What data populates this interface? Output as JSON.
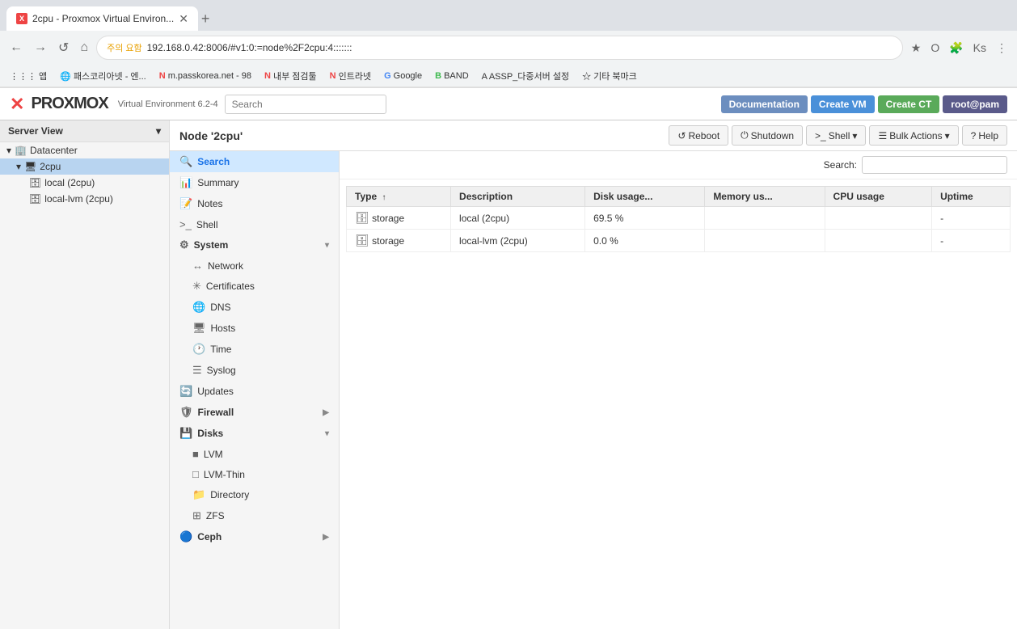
{
  "browser": {
    "tab_title": "2cpu - Proxmox Virtual Environ...",
    "tab_add": "+",
    "back": "←",
    "forward": "→",
    "reload": "↺",
    "home": "⌂",
    "warning_text": "주의 요함",
    "address": "192.168.0.42:8006/#v1:0:=node%2F2cpu:4:::::::",
    "star_icon": "★",
    "opera_icon": "O",
    "ext_icon": "🧩",
    "profile_icon": "Ks",
    "menu_icon": "⋮",
    "bookmarks": [
      {
        "id": "apps",
        "icon": "⋮⋮⋮",
        "label": "앱"
      },
      {
        "id": "passkorea",
        "icon": "🌐",
        "label": "패스코리아넷 - 엔..."
      },
      {
        "id": "mpass",
        "icon": "N",
        "label": "m.passkorea.net - 98"
      },
      {
        "id": "internal",
        "icon": "N",
        "label": "내부 점검툴"
      },
      {
        "id": "intranet",
        "icon": "N",
        "label": "인트라넷"
      },
      {
        "id": "google",
        "icon": "G",
        "label": "Google"
      },
      {
        "id": "band",
        "icon": "B",
        "label": "BAND"
      },
      {
        "id": "assp",
        "icon": "A",
        "label": "ASSP_다중서버 설정"
      },
      {
        "id": "other",
        "icon": "☆",
        "label": "기타 북마크"
      }
    ]
  },
  "app": {
    "logo_text": "PROXMOX",
    "logo_subtitle": "Virtual Environment 6.2-4",
    "search_placeholder": "Search",
    "header_buttons": {
      "documentation": "Documentation",
      "create_vm": "Create VM",
      "create_ct": "Create CT",
      "user": "root@pam"
    }
  },
  "sidebar": {
    "server_view_label": "Server View",
    "items": [
      {
        "id": "datacenter",
        "label": "Datacenter",
        "level": 0,
        "icon": "🏢",
        "expanded": true
      },
      {
        "id": "2cpu",
        "label": "2cpu",
        "level": 1,
        "icon": "💻",
        "selected": true,
        "expanded": true
      },
      {
        "id": "local",
        "label": "local (2cpu)",
        "level": 2,
        "icon": "🗄"
      },
      {
        "id": "local-lvm",
        "label": "local-lvm (2cpu)",
        "level": 2,
        "icon": "🗄"
      }
    ]
  },
  "node_panel": {
    "title": "Node '2cpu'",
    "buttons": {
      "reboot": "Reboot",
      "shutdown": "Shutdown",
      "shell": "Shell",
      "bulk_actions": "Bulk Actions",
      "help": "Help"
    }
  },
  "sub_nav": {
    "items": [
      {
        "id": "search",
        "label": "Search",
        "icon": "🔍",
        "active": true
      },
      {
        "id": "summary",
        "label": "Summary",
        "icon": "📊"
      },
      {
        "id": "notes",
        "label": "Notes",
        "icon": "📝"
      },
      {
        "id": "shell",
        "label": "Shell",
        "icon": ">_"
      },
      {
        "id": "system",
        "label": "System",
        "icon": "⚙",
        "expandable": true,
        "expanded": true
      },
      {
        "id": "network",
        "label": "Network",
        "icon": "↔",
        "sub": true
      },
      {
        "id": "certificates",
        "label": "Certificates",
        "icon": "✳",
        "sub": true
      },
      {
        "id": "dns",
        "label": "DNS",
        "icon": "🌐",
        "sub": true
      },
      {
        "id": "hosts",
        "label": "Hosts",
        "icon": "🖥",
        "sub": true
      },
      {
        "id": "time",
        "label": "Time",
        "icon": "🕐",
        "sub": true
      },
      {
        "id": "syslog",
        "label": "Syslog",
        "icon": "☰",
        "sub": true
      },
      {
        "id": "updates",
        "label": "Updates",
        "icon": "🔄"
      },
      {
        "id": "firewall",
        "label": "Firewall",
        "icon": "🛡",
        "expandable": true
      },
      {
        "id": "disks",
        "label": "Disks",
        "icon": "💾",
        "expandable": true,
        "expanded": true
      },
      {
        "id": "lvm",
        "label": "LVM",
        "icon": "■",
        "sub": true
      },
      {
        "id": "lvm-thin",
        "label": "LVM-Thin",
        "icon": "□",
        "sub": true
      },
      {
        "id": "directory",
        "label": "Directory",
        "icon": "📁",
        "sub": true
      },
      {
        "id": "zfs",
        "label": "ZFS",
        "icon": "⊞",
        "sub": true
      },
      {
        "id": "ceph",
        "label": "Ceph",
        "icon": "🔵",
        "expandable": true
      }
    ]
  },
  "content": {
    "search_label": "Search:",
    "search_placeholder": "",
    "table": {
      "columns": [
        {
          "id": "type",
          "label": "Type",
          "sort": "asc"
        },
        {
          "id": "description",
          "label": "Description"
        },
        {
          "id": "disk_usage",
          "label": "Disk usage..."
        },
        {
          "id": "memory_usage",
          "label": "Memory us..."
        },
        {
          "id": "cpu_usage",
          "label": "CPU usage"
        },
        {
          "id": "uptime",
          "label": "Uptime"
        }
      ],
      "rows": [
        {
          "type": "storage",
          "description": "local (2cpu)",
          "disk_usage": "69.5 %",
          "memory_usage": "",
          "cpu_usage": "",
          "uptime": "-"
        },
        {
          "type": "storage",
          "description": "local-lvm (2cpu)",
          "disk_usage": "0.0 %",
          "memory_usage": "",
          "cpu_usage": "",
          "uptime": "-"
        }
      ]
    }
  }
}
